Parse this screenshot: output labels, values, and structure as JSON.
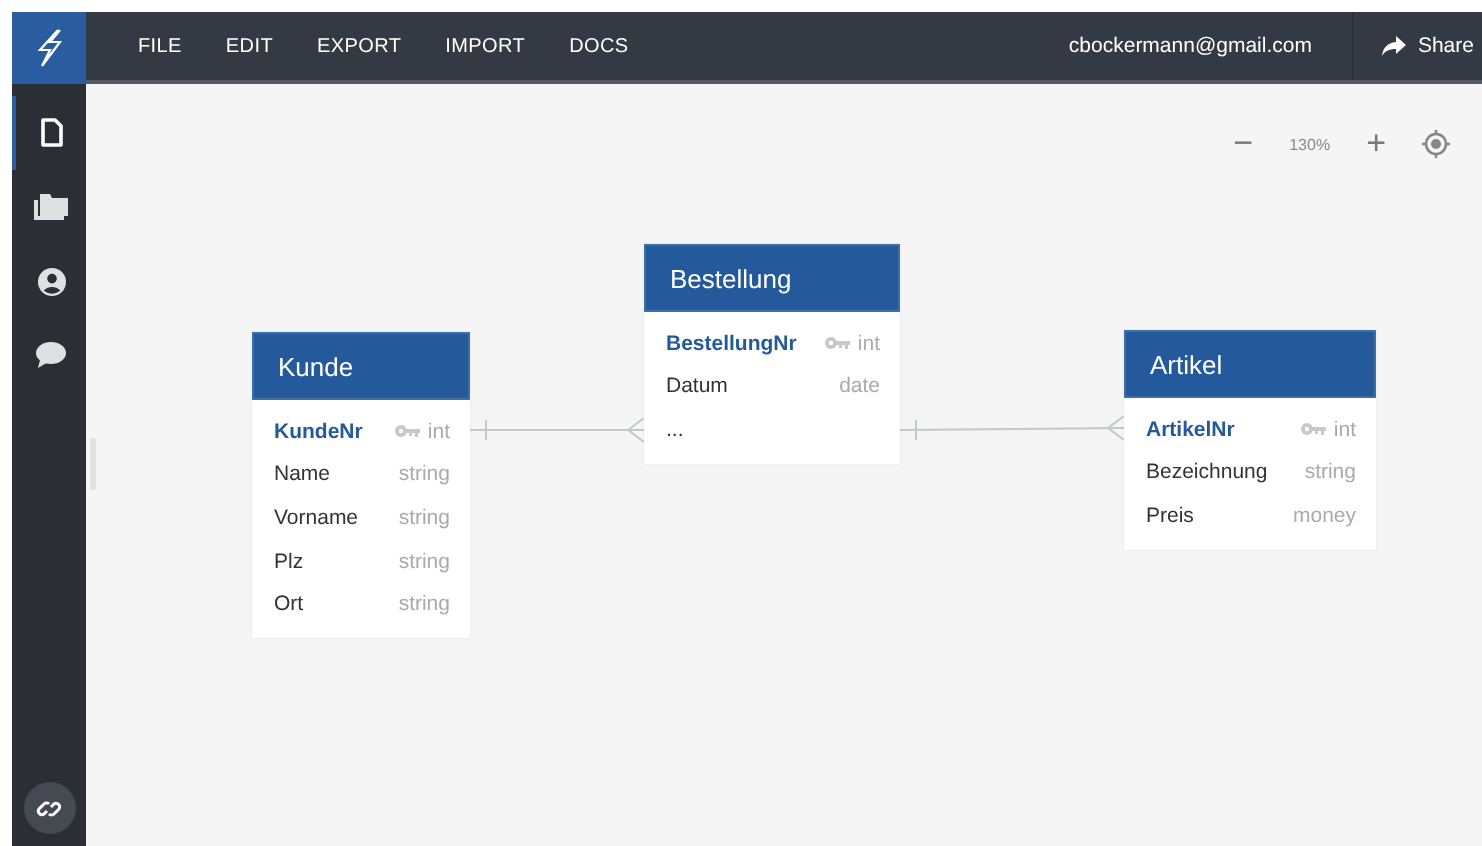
{
  "menu": [
    "FILE",
    "EDIT",
    "EXPORT",
    "IMPORT",
    "DOCS"
  ],
  "account": {
    "email": "cbockermann@gmail.com",
    "share": "Share"
  },
  "sidebar": {
    "items": [
      {
        "kind": "file",
        "selected": true
      },
      {
        "kind": "folder",
        "selected": false
      },
      {
        "kind": "user",
        "selected": false
      },
      {
        "kind": "chat",
        "selected": false
      }
    ]
  },
  "zoom": {
    "minus": "−",
    "value": "130%",
    "plus": "+"
  },
  "entities": [
    {
      "name": "Kunde",
      "fields": [
        {
          "name": "KundeNr",
          "type": "int",
          "key": true
        },
        {
          "name": "Name",
          "type": "string",
          "key": false
        },
        {
          "name": "Vorname",
          "type": "string",
          "key": false
        },
        {
          "name": "Plz",
          "type": "string",
          "key": false
        },
        {
          "name": "Ort",
          "type": "string",
          "key": false
        }
      ]
    },
    {
      "name": "Bestellung",
      "fields": [
        {
          "name": "BestellungNr",
          "type": "int",
          "key": true
        },
        {
          "name": "Datum",
          "type": "date",
          "key": false
        },
        {
          "name": "...",
          "key": false
        }
      ]
    },
    {
      "name": "Artikel",
      "fields": [
        {
          "name": "ArtikelNr",
          "type": "int",
          "key": true
        },
        {
          "name": "Bezeichnung",
          "type": "string",
          "key": false
        },
        {
          "name": "Preis",
          "type": "money",
          "key": false
        }
      ]
    }
  ]
}
